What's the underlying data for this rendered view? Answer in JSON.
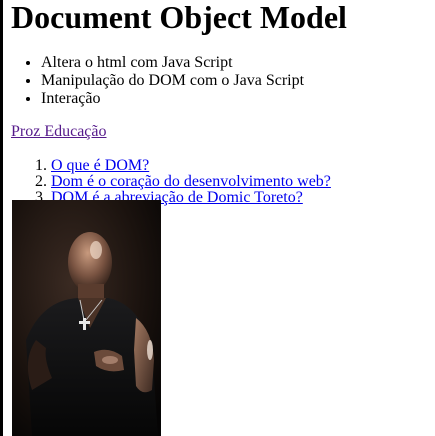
{
  "page": {
    "heading": "Document Object Model",
    "features": [
      "Altera o html com Java Script",
      "Manipulação do DOM com o Java Script",
      "Interação"
    ],
    "org_link": "Proz Educação",
    "questions": [
      "O que é DOM?",
      "Dom é o coração do desenvolvimento web?",
      "DOM é a abreviação de Domic Toreto?"
    ],
    "image": {
      "subject": "photo of a bald man in a black shirt with a cross necklace"
    }
  },
  "colors": {
    "visited_link": "#551a8b",
    "link": "#0000ee",
    "text": "#000000",
    "background": "#ffffff"
  }
}
